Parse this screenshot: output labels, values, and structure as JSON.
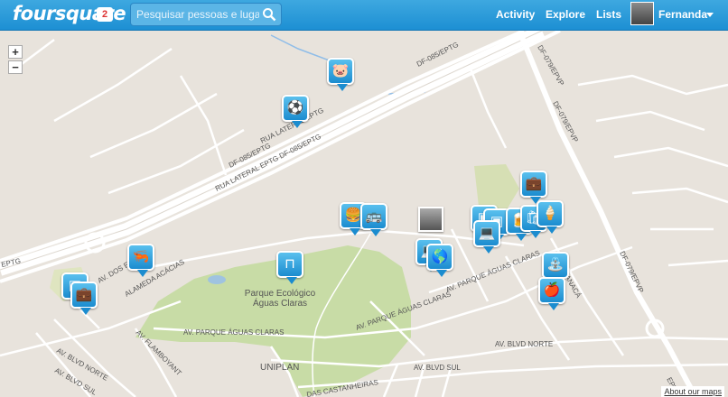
{
  "header": {
    "logo": "foursquare",
    "notification_count": "2",
    "search_placeholder": "Pesquisar pessoas e lugares...",
    "nav": [
      "Activity",
      "Explore",
      "Lists"
    ],
    "user_name": "Fernanda"
  },
  "map": {
    "zoom_in": "+",
    "zoom_out": "−",
    "park_label_1": "Parque Ecológico",
    "park_label_2": "Águas Claras",
    "uniplan": "UNIPLAN",
    "about_link": "About our maps",
    "road_labels": {
      "r1": "DF-085/EPTG",
      "r2": "RUA LATERAL EPTG",
      "r3": "DF-085/EPTG",
      "r4": "RUA LATERAL EPTG  DF-085/EPTG",
      "r5": "DF-079/EPVP",
      "r6": "DF-079/EPVP",
      "r7": "DF-079/EPVP",
      "r8": "AV. PARQUE ÁGUAS CLARAS",
      "r9": "AV. PARQUE ÁGUAS CLARAS",
      "r10": "AV. PARQUE ÁGUAS CLARAS",
      "r11": "AV. BLVD NORTE",
      "r12": "AV. BLVD NORTE",
      "r13": "AV. BLVD SUL",
      "r14": "AV. BLVD SUL",
      "r15": "AV. FLAMBOYANT",
      "r16": "ALAMEDA ACÁCIAS",
      "r17": "AV. DOS E",
      "r18": "AV. MANACÁ",
      "r19": "DAS CASTANHEIRAS",
      "r20": "EPTG",
      "r21": "EPVP"
    },
    "pins": [
      {
        "icon": "piggy-bank-icon",
        "glyph": "🐷"
      },
      {
        "icon": "soccer-ball-icon",
        "glyph": "⚽"
      },
      {
        "icon": "burger-icon",
        "glyph": "🍔"
      },
      {
        "icon": "bus-icon",
        "glyph": "🚌"
      },
      {
        "icon": "bench-icon",
        "glyph": "⊓"
      },
      {
        "icon": "shrimp-icon",
        "glyph": "🦐"
      },
      {
        "icon": "store-icon",
        "glyph": "▣"
      },
      {
        "icon": "suitcase-icon",
        "glyph": "💼"
      },
      {
        "icon": "laptop-icon",
        "glyph": "💻"
      },
      {
        "icon": "beer-icon",
        "glyph": "🍺"
      },
      {
        "icon": "shopping-bag-icon",
        "glyph": "🛍"
      },
      {
        "icon": "ice-cream-icon",
        "glyph": "🍦"
      },
      {
        "icon": "south-america-icon",
        "glyph": "🌎"
      },
      {
        "icon": "fountain-icon",
        "glyph": "⛲"
      },
      {
        "icon": "apple-icon",
        "glyph": "🍎"
      }
    ]
  }
}
